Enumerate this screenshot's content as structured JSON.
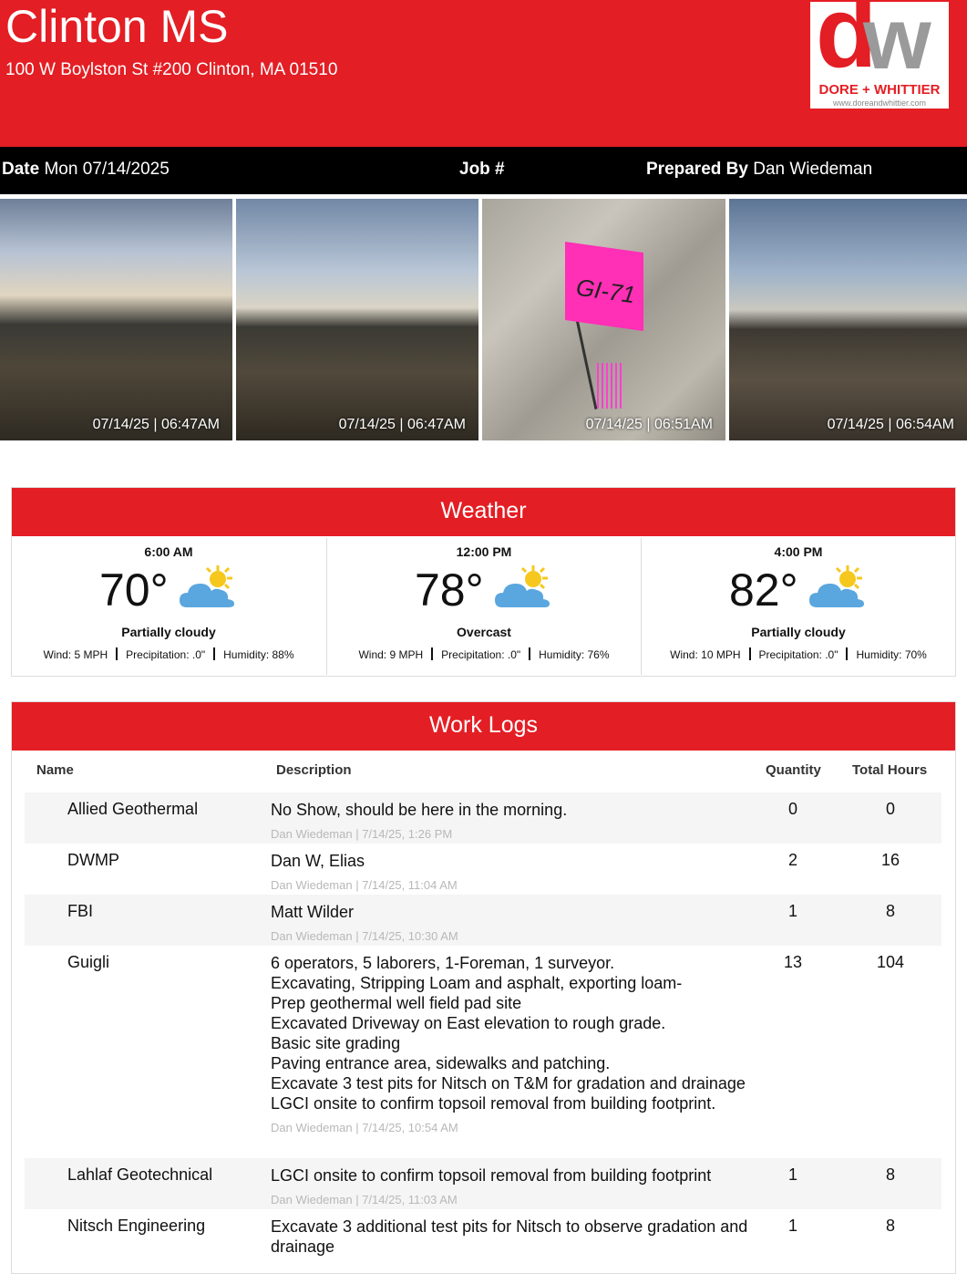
{
  "header": {
    "title": "Clinton MS",
    "address": "100 W Boylston St #200 Clinton, MA 01510",
    "logo_letters_d": "d",
    "logo_letters_w": "w",
    "logo_brand": "DORE + WHITTIER",
    "logo_url": "www.doreandwhittier.com"
  },
  "info": {
    "date_label": "Date",
    "date_value": "Mon 07/14/2025",
    "job_label": "Job #",
    "prepared_label": "Prepared By",
    "prepared_value": "Dan Wiedeman"
  },
  "photos": [
    {
      "timestamp": "07/14/25 | 06:47AM"
    },
    {
      "timestamp": "07/14/25 | 06:47AM"
    },
    {
      "timestamp": "07/14/25 | 06:51AM",
      "flag_text": "GI-71"
    },
    {
      "timestamp": "07/14/25 | 06:54AM"
    }
  ],
  "weather": {
    "title": "Weather",
    "slots": [
      {
        "time": "6:00 AM",
        "temp": "70°",
        "condition": "Partially cloudy",
        "wind": "Wind: 5 MPH",
        "precip": "Precipitation: .0\"",
        "humidity": "Humidity: 88%"
      },
      {
        "time": "12:00 PM",
        "temp": "78°",
        "condition": "Overcast",
        "wind": "Wind: 9 MPH",
        "precip": "Precipitation: .0\"",
        "humidity": "Humidity: 76%"
      },
      {
        "time": "4:00 PM",
        "temp": "82°",
        "condition": "Partially cloudy",
        "wind": "Wind: 10 MPH",
        "precip": "Precipitation: .0\"",
        "humidity": "Humidity: 70%"
      }
    ],
    "icon": "partly-cloudy-icon",
    "colors": {
      "cloud": "#5aa6de",
      "sun": "#f6c81e"
    }
  },
  "worklogs": {
    "title": "Work Logs",
    "columns": {
      "name": "Name",
      "description": "Description",
      "quantity": "Quantity",
      "hours": "Total Hours"
    },
    "rows": [
      {
        "name": "Allied Geothermal",
        "description": [
          "No Show, should be here in the morning."
        ],
        "meta": "Dan Wiedeman | 7/14/25, 1:26 PM",
        "quantity": "0",
        "hours": "0"
      },
      {
        "name": "DWMP",
        "description": [
          "Dan W, Elias"
        ],
        "meta": "Dan Wiedeman | 7/14/25, 11:04 AM",
        "quantity": "2",
        "hours": "16"
      },
      {
        "name": "FBI",
        "description": [
          "Matt Wilder"
        ],
        "meta": "Dan Wiedeman | 7/14/25, 10:30 AM",
        "quantity": "1",
        "hours": "8"
      },
      {
        "name": "Guigli",
        "description": [
          "6 operators, 5 laborers, 1-Foreman, 1 surveyor.",
          "Excavating, Stripping Loam and asphalt, exporting loam-",
          "Prep geothermal well field pad site",
          "Excavated Driveway on East elevation to rough grade.",
          "Basic site grading",
          "Paving entrance area, sidewalks and patching.",
          "Excavate 3 test pits for Nitsch on T&M for gradation and drainage",
          "LGCI onsite to confirm topsoil removal from building footprint."
        ],
        "meta": "Dan Wiedeman | 7/14/25, 10:54 AM",
        "quantity": "13",
        "hours": "104"
      },
      {
        "name": "Lahlaf Geotechnical",
        "description": [
          "LGCI onsite to confirm topsoil removal from building footprint"
        ],
        "meta": "Dan Wiedeman | 7/14/25, 11:03 AM",
        "quantity": "1",
        "hours": "8"
      },
      {
        "name": "Nitsch Engineering",
        "description": [
          "Excavate 3 additional test pits for Nitsch to observe gradation and drainage"
        ],
        "meta": "",
        "quantity": "1",
        "hours": "8"
      }
    ]
  },
  "colors": {
    "brand_red": "#e31e24",
    "bar_black": "#000000",
    "logo_gray": "#9a9a9a"
  }
}
